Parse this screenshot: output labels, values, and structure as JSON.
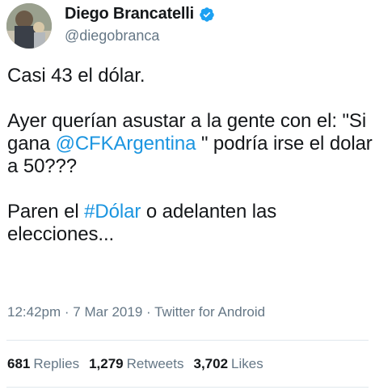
{
  "user": {
    "display_name": "Diego Brancatelli",
    "handle": "@diegobranca",
    "verified": true
  },
  "tweet": {
    "line1": "Casi 43 el dólar.",
    "line2_pre": "Ayer querían asustar a la gente con el: \"Si gana ",
    "mention": "@CFKArgentina",
    "line2_post": " \" podría irse el dolar a 50???",
    "line3_pre": "Paren el ",
    "hashtag": "#Dólar",
    "line3_post": " o adelanten las elecciones..."
  },
  "meta": {
    "time": "12:42pm",
    "separator1": " · ",
    "date": "7 Mar 2019",
    "separator2": " · ",
    "client": "Twitter for Android"
  },
  "stats": {
    "replies_count": "681",
    "replies_label": "Replies",
    "retweets_count": "1,279",
    "retweets_label": "Retweets",
    "likes_count": "3,702",
    "likes_label": "Likes"
  },
  "colors": {
    "link": "#1b95e0",
    "verified": "#1da1f2",
    "secondary_text": "#657786"
  },
  "icons": {
    "verified": "verified-badge-icon"
  }
}
